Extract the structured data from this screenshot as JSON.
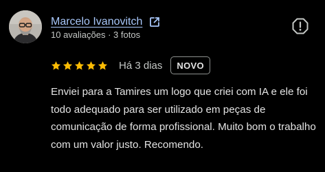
{
  "review": {
    "author_name": "Marcelo Ivanovitch",
    "author_meta": "10 avaliações · 3 fotos",
    "rating": 5,
    "rating_max": 5,
    "date": "Há 3 dias",
    "badge": "NOVO",
    "text": "Enviei para a Tamires um logo que criei com IA e ele foi todo adequado para ser utilizado em peças de comunicação de forma profissional. Muito bom o trabalho com um valor justo. Recomendo."
  },
  "icons": {
    "external_link": "external-link-icon",
    "report": "report-icon",
    "star": "star-icon"
  },
  "colors": {
    "background": "#000000",
    "link": "#a8c7fa",
    "star": "#fbbc04",
    "text_primary": "#e3e3e3",
    "text_secondary": "#c4c7c5"
  }
}
